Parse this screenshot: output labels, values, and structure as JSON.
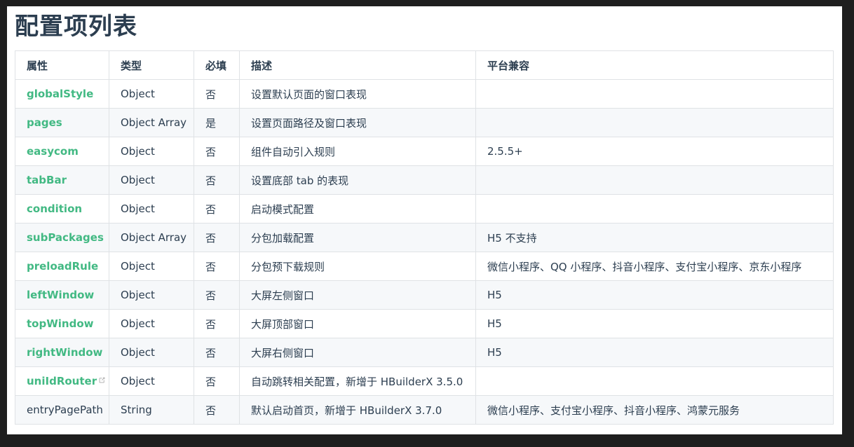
{
  "title": "配置项列表",
  "colors": {
    "link": "#42b983",
    "text": "#2c3e50",
    "border": "#dfe2e5",
    "stripe": "#f6f8fa"
  },
  "table": {
    "headers": [
      "属性",
      "类型",
      "必填",
      "描述",
      "平台兼容"
    ],
    "rows": [
      {
        "prop": "globalStyle",
        "type": "Object",
        "required": "否",
        "desc": "设置默认页面的窗口表现",
        "platform": "",
        "link": true,
        "external": false
      },
      {
        "prop": "pages",
        "type": "Object Array",
        "required": "是",
        "desc": "设置页面路径及窗口表现",
        "platform": "",
        "link": true,
        "external": false
      },
      {
        "prop": "easycom",
        "type": "Object",
        "required": "否",
        "desc": "组件自动引入规则",
        "platform": "2.5.5+",
        "link": true,
        "external": false
      },
      {
        "prop": "tabBar",
        "type": "Object",
        "required": "否",
        "desc": "设置底部 tab 的表现",
        "platform": "",
        "link": true,
        "external": false
      },
      {
        "prop": "condition",
        "type": "Object",
        "required": "否",
        "desc": "启动模式配置",
        "platform": "",
        "link": true,
        "external": false
      },
      {
        "prop": "subPackages",
        "type": "Object Array",
        "required": "否",
        "desc": "分包加载配置",
        "platform": "H5 不支持",
        "link": true,
        "external": false
      },
      {
        "prop": "preloadRule",
        "type": "Object",
        "required": "否",
        "desc": "分包预下载规则",
        "platform": "微信小程序、QQ 小程序、抖音小程序、支付宝小程序、京东小程序",
        "link": true,
        "external": false
      },
      {
        "prop": "leftWindow",
        "type": "Object",
        "required": "否",
        "desc": "大屏左侧窗口",
        "platform": "H5",
        "link": true,
        "external": false
      },
      {
        "prop": "topWindow",
        "type": "Object",
        "required": "否",
        "desc": "大屏顶部窗口",
        "platform": "H5",
        "link": true,
        "external": false
      },
      {
        "prop": "rightWindow",
        "type": "Object",
        "required": "否",
        "desc": "大屏右侧窗口",
        "platform": "H5",
        "link": true,
        "external": false
      },
      {
        "prop": "uniIdRouter",
        "type": "Object",
        "required": "否",
        "desc": "自动跳转相关配置，新增于 HBuilderX 3.5.0",
        "platform": "",
        "link": true,
        "external": true
      },
      {
        "prop": "entryPagePath",
        "type": "String",
        "required": "否",
        "desc": "默认启动首页，新增于 HBuilderX 3.7.0",
        "platform": "微信小程序、支付宝小程序、抖音小程序、鸿蒙元服务",
        "link": false,
        "external": false
      }
    ]
  }
}
